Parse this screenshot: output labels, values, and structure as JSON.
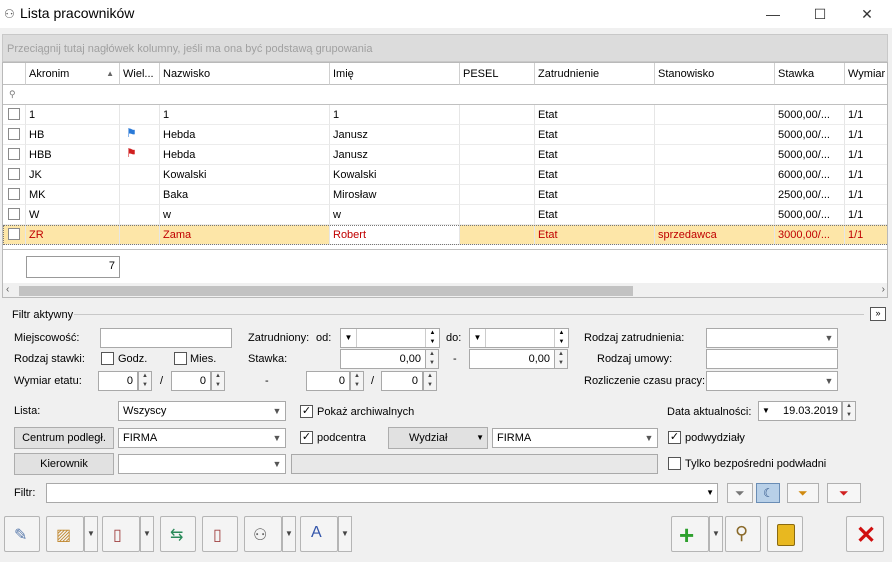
{
  "window": {
    "title": "Lista pracowników"
  },
  "grid": {
    "group_hint": "Przeciągnij tutaj nagłówek kolumny, jeśli ma ona być podstawą grupowania",
    "columns": [
      "Akronim",
      "Wiel...",
      "Nazwisko",
      "Imię",
      "PESEL",
      "Zatrudnienie",
      "Stanowisko",
      "Stawka",
      "Wymiar"
    ],
    "rows": [
      {
        "akronim": "1",
        "flag": "",
        "nazwisko": "1",
        "imie": "1",
        "pesel": "",
        "zatrudnienie": "Etat",
        "stanowisko": "",
        "stawka": "5000,00/...",
        "wymiar": "1/1"
      },
      {
        "akronim": "HB",
        "flag": "blue",
        "nazwisko": "Hebda",
        "imie": "Janusz",
        "pesel": "",
        "zatrudnienie": "Etat",
        "stanowisko": "",
        "stawka": "5000,00/...",
        "wymiar": "1/1"
      },
      {
        "akronim": "HBB",
        "flag": "red",
        "nazwisko": "Hebda",
        "imie": "Janusz",
        "pesel": "",
        "zatrudnienie": "Etat",
        "stanowisko": "",
        "stawka": "5000,00/...",
        "wymiar": "1/1"
      },
      {
        "akronim": "JK",
        "flag": "",
        "nazwisko": "Kowalski",
        "imie": "Kowalski",
        "pesel": "",
        "zatrudnienie": "Etat",
        "stanowisko": "",
        "stawka": "6000,00/...",
        "wymiar": "1/1"
      },
      {
        "akronim": "MK",
        "flag": "",
        "nazwisko": "Baka",
        "imie": "Mirosław",
        "pesel": "",
        "zatrudnienie": "Etat",
        "stanowisko": "",
        "stawka": "2500,00/...",
        "wymiar": "1/1"
      },
      {
        "akronim": "W",
        "flag": "",
        "nazwisko": "w",
        "imie": "w",
        "pesel": "",
        "zatrudnienie": "Etat",
        "stanowisko": "",
        "stawka": "5000,00/...",
        "wymiar": "1/1"
      },
      {
        "akronim": "ZR",
        "flag": "",
        "nazwisko": "Zama",
        "imie": "Robert",
        "pesel": "",
        "zatrudnienie": "Etat",
        "stanowisko": "sprzedawca",
        "stawka": "3000,00/...",
        "wymiar": "1/1",
        "selected": true
      }
    ],
    "footer_count": "7"
  },
  "filter": {
    "section_title": "Filtr aktywny",
    "miejscowosc_label": "Miejscowość:",
    "miejscowosc_value": "",
    "zatrudniony_label": "Zatrudniony:",
    "od_label": "od:",
    "do_label": "do:",
    "rodzaj_zatrudnienia_label": "Rodzaj zatrudnienia:",
    "rodzaj_stawki_label": "Rodzaj stawki:",
    "godz_label": "Godz.",
    "godz_checked": false,
    "mies_label": "Mies.",
    "mies_checked": false,
    "stawka_label": "Stawka:",
    "stawka_from": "0,00",
    "stawka_dash": "-",
    "stawka_to": "0,00",
    "rodzaj_umowy_label": "Rodzaj umowy:",
    "wymiar_label": "Wymiar etatu:",
    "wymiar_a1": "0",
    "wymiar_slash": "/",
    "wymiar_a2": "0",
    "wymiar_dash": "-",
    "wymiar_b1": "0",
    "wymiar_b2": "0",
    "rozliczenie_label": "Rozliczenie czasu pracy:",
    "lista_label": "Lista:",
    "lista_value": "Wszyscy",
    "pokaz_archiwalnych_label": "Pokaż archiwalnych",
    "pokaz_archiwalnych_checked": true,
    "data_label": "Data aktualności:",
    "data_value": "19.03.2019",
    "centrum_button": "Centrum podległ.",
    "centrum_value": "FIRMA",
    "podcentra_label": "podcentra",
    "podcentra_checked": true,
    "wydzial_button": "Wydział",
    "wydzial_value": "FIRMA",
    "podwydzialy_label": "podwydziały",
    "podwydzialy_checked": true,
    "kierownik_button": "Kierownik",
    "kierownik_value": "",
    "bezposredni_label": "Tylko bezpośredni podwładni",
    "bezposredni_checked": false,
    "filtr_label": "Filtr:",
    "filtr_value": ""
  },
  "toolbar": {
    "left_icons": [
      "employee-list-icon",
      "chart-icon",
      "door-icon",
      "transfer-icon",
      "exit-door-icon",
      "group-icon",
      "edit-text-icon"
    ],
    "right_icons": [
      "add-icon",
      "search-icon",
      "delete-icon",
      "close-icon"
    ]
  },
  "colors": {
    "selected_row": "#fde6a8",
    "selected_text": "#c00000",
    "add_green": "#2ea02e",
    "close_red": "#d01010"
  }
}
